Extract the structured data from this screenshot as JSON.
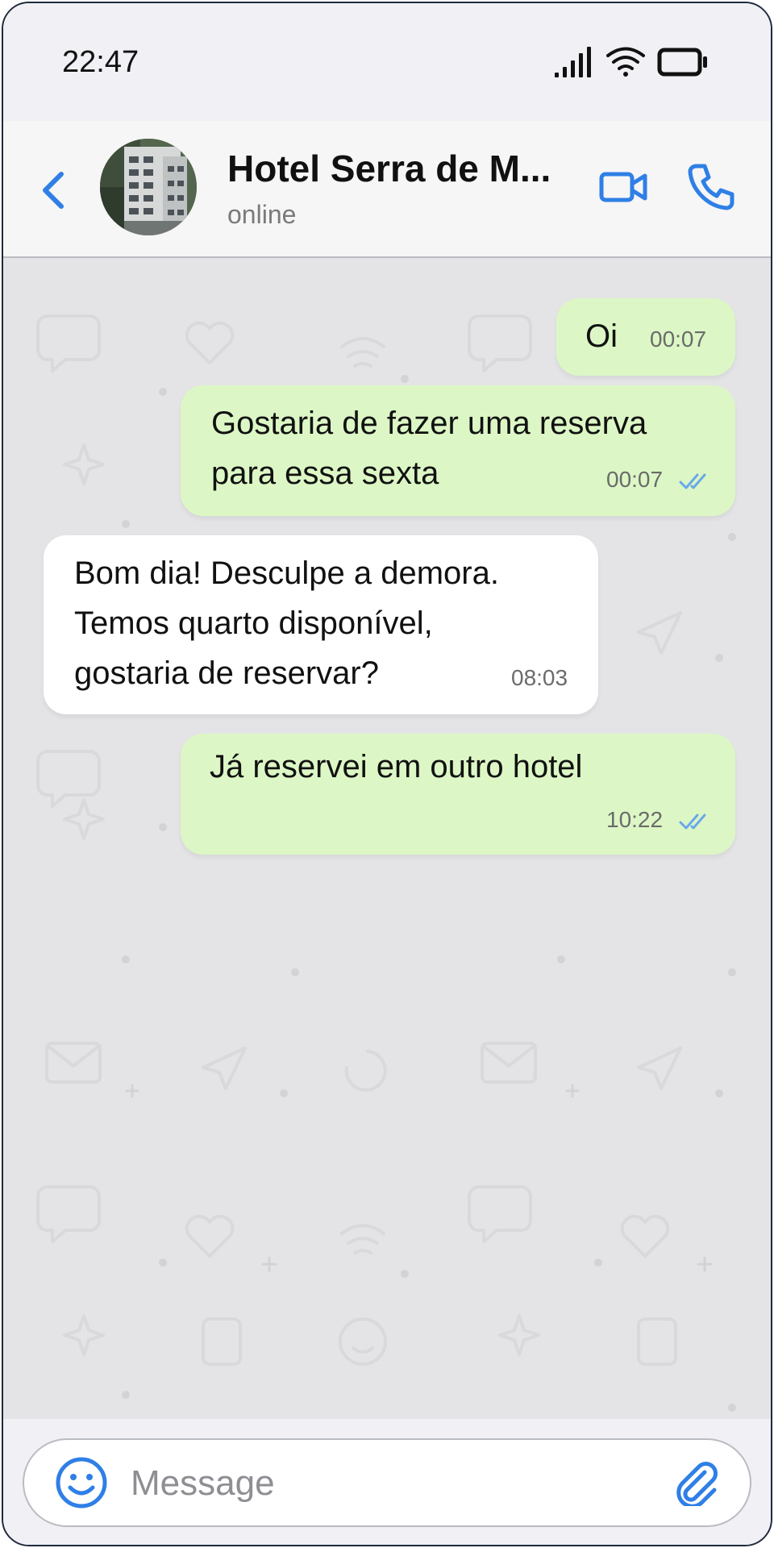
{
  "status_bar": {
    "time": "22:47"
  },
  "header": {
    "back_label": "back",
    "contact_name": "Hotel Serra de M...",
    "contact_status": "online"
  },
  "messages": [
    {
      "direction": "outgoing",
      "lines": [
        "Oi"
      ],
      "time": "00:07",
      "read_ticks": false
    },
    {
      "direction": "outgoing",
      "lines": [
        "Gostaria de fazer uma reserva",
        "para essa sexta"
      ],
      "time": "00:07",
      "read_ticks": true
    },
    {
      "direction": "incoming",
      "lines": [
        "Bom dia! Desculpe a demora.",
        "Temos quarto disponível,",
        "gostaria de reservar?"
      ],
      "time": "08:03",
      "read_ticks": false
    },
    {
      "direction": "outgoing",
      "lines": [
        "Já reservei em outro hotel"
      ],
      "time": "10:22",
      "read_ticks": true
    }
  ],
  "composer": {
    "placeholder": "Message"
  },
  "colors": {
    "accent": "#2f7fe6",
    "outgoing_bubble": "#dcf7c5",
    "incoming_bubble": "#ffffff",
    "chat_background": "#e4e4e6",
    "read_ticks": "#6aa8ea"
  },
  "icons": {
    "back": "chevron-left-icon",
    "video": "video-camera-icon",
    "call": "phone-icon",
    "emoji": "smiley-icon",
    "attach": "paperclip-icon",
    "signal": "signal-bars-icon",
    "wifi": "wifi-icon",
    "battery": "battery-icon"
  }
}
